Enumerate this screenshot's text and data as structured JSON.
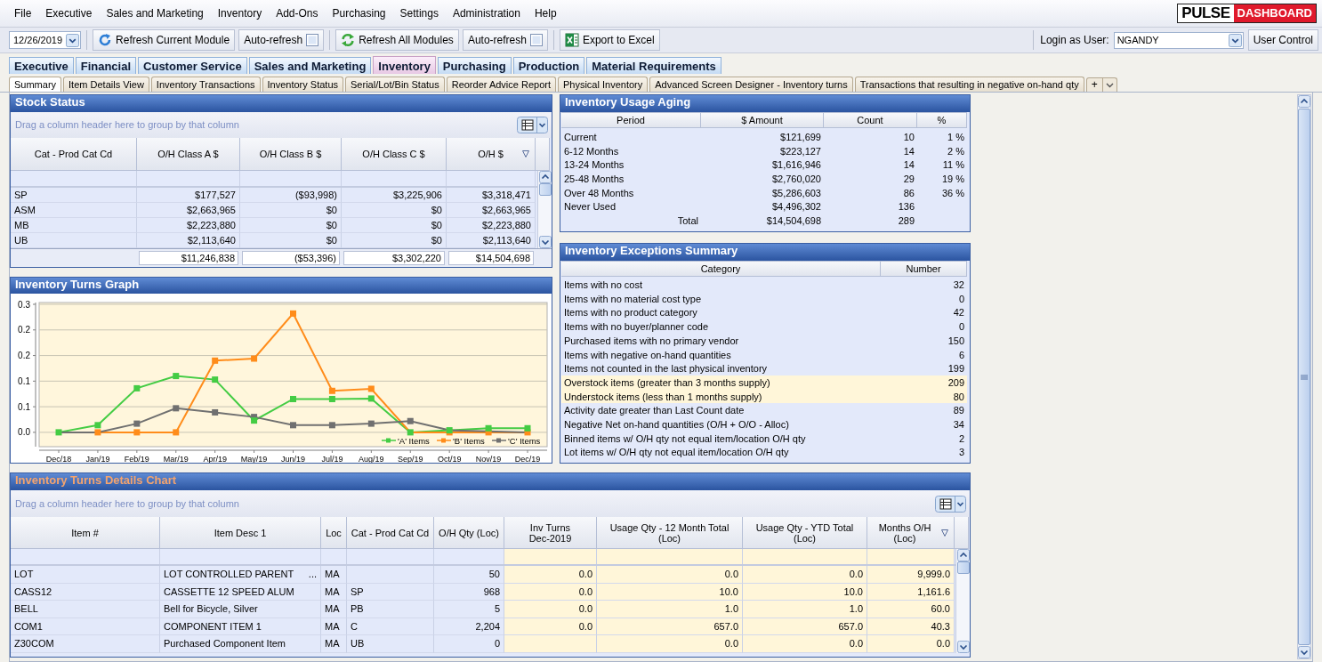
{
  "menu": [
    "File",
    "Executive",
    "Sales and Marketing",
    "Inventory",
    "Add-Ons",
    "Purchasing",
    "Settings",
    "Administration",
    "Help"
  ],
  "logo": {
    "left": "PULSE",
    "right": "DASHBOARD"
  },
  "toolbar": {
    "date": "12/26/2019",
    "refresh_current": "Refresh Current Module",
    "auto_refresh": [
      {
        "label": "Auto-refresh",
        "checked": false
      },
      {
        "label": "Auto-refresh",
        "checked": false
      }
    ],
    "refresh_all": "Refresh All Modules",
    "export": "Export to Excel",
    "login_label": "Login as User:",
    "login_user": "NGANDY",
    "user_control": "User Control"
  },
  "module_tabs": [
    {
      "label": "Executive",
      "selected": false
    },
    {
      "label": "Financial",
      "selected": false
    },
    {
      "label": "Customer Service",
      "selected": false
    },
    {
      "label": "Sales and Marketing",
      "selected": false
    },
    {
      "label": "Inventory",
      "selected": true
    },
    {
      "label": "Purchasing",
      "selected": false
    },
    {
      "label": "Production",
      "selected": false
    },
    {
      "label": "Material Requirements",
      "selected": false
    }
  ],
  "sub_tabs": [
    {
      "label": "Summary",
      "selected": true
    },
    {
      "label": "Item Details View",
      "selected": false
    },
    {
      "label": "Inventory Transactions",
      "selected": false
    },
    {
      "label": "Inventory Status",
      "selected": false
    },
    {
      "label": "Serial/Lot/Bin Status",
      "selected": false
    },
    {
      "label": "Reorder Advice Report",
      "selected": false
    },
    {
      "label": "Physical Inventory",
      "selected": false
    },
    {
      "label": "Advanced Screen Designer - Inventory turns",
      "selected": false
    },
    {
      "label": "Transactions that resulting in negative on-hand qty",
      "selected": false
    }
  ],
  "add_tab": "+",
  "stock_status": {
    "title": "Stock Status",
    "title_highlighted": false,
    "group_hint": "Drag a column header here to group by that column",
    "columns": [
      {
        "label": "Cat - Prod Cat Cd",
        "sorted": false
      },
      {
        "label": "O/H Class A $",
        "sorted": false
      },
      {
        "label": "O/H Class B $",
        "sorted": false
      },
      {
        "label": "O/H Class C $",
        "sorted": false
      },
      {
        "label": "O/H $",
        "sorted": true
      }
    ],
    "rows": [
      [
        "SP",
        "$177,527",
        "($93,998)",
        "$3,225,906",
        "$3,318,471"
      ],
      [
        "ASM",
        "$2,663,965",
        "$0",
        "$0",
        "$2,663,965"
      ],
      [
        "MB",
        "$2,223,880",
        "$0",
        "$0",
        "$2,223,880"
      ],
      [
        "UB",
        "$2,113,640",
        "$0",
        "$0",
        "$2,113,640"
      ]
    ],
    "totals": [
      "$11,246,838",
      "($53,396)",
      "$3,302,220",
      "$14,504,698"
    ]
  },
  "turns_graph": {
    "title": "Inventory Turns Graph",
    "title_highlighted": false,
    "chart_data": {
      "type": "line",
      "categories": [
        "Dec/18",
        "Jan/19",
        "Feb/19",
        "Mar/19",
        "Apr/19",
        "May/19",
        "Jun/19",
        "Jul/19",
        "Aug/19",
        "Sep/19",
        "Oct/19",
        "Nov/19",
        "Dec/19"
      ],
      "ylim": [
        -0.028,
        0.2535
      ],
      "grid": true,
      "legend": true,
      "yticks": [
        {
          "value": 0,
          "label": "0.0"
        },
        {
          "value": 0.05,
          "label": "0.1"
        },
        {
          "value": 0.1,
          "label": "0.1"
        },
        {
          "value": 0.15,
          "label": "0.2"
        },
        {
          "value": 0.2,
          "label": "0.2"
        },
        {
          "value": 0.25,
          "label": "0.3"
        }
      ],
      "series": [
        {
          "name": "'A' Items",
          "color": "#44cc44",
          "marker": "square",
          "values": [
            0,
            0.014,
            0.086,
            0.11,
            0.103,
            0.023,
            0.065,
            0.065,
            0.066,
            0,
            0.004,
            0.008,
            0.008
          ]
        },
        {
          "name": "'B' Items",
          "color": "#ff8c1a",
          "marker": "square",
          "values": [
            null,
            0,
            0,
            0,
            0.14,
            0.144,
            0.232,
            0.081,
            0.085,
            0,
            0,
            0,
            0
          ]
        },
        {
          "name": "'C' Items",
          "color": "#707070",
          "marker": "square",
          "values": [
            0,
            0,
            0.017,
            0.047,
            0.039,
            0.03,
            0.014,
            0.014,
            0.017,
            0.022,
            0.004,
            0.002,
            0
          ]
        }
      ]
    }
  },
  "aging": {
    "title": "Inventory Usage Aging",
    "title_highlighted": false,
    "columns": [
      "Period",
      "$ Amount",
      "Count",
      "%"
    ],
    "rows": [
      {
        "period": "Current",
        "amount": "$121,699",
        "count": "10",
        "pct": "1 %"
      },
      {
        "period": "6-12 Months",
        "amount": "$223,127",
        "count": "14",
        "pct": "2 %"
      },
      {
        "period": "13-24 Months",
        "amount": "$1,616,946",
        "count": "14",
        "pct": "11 %"
      },
      {
        "period": "25-48 Months",
        "amount": "$2,760,020",
        "count": "29",
        "pct": "19 %"
      },
      {
        "period": "Over 48 Months",
        "amount": "$5,286,603",
        "count": "86",
        "pct": "36 %"
      },
      {
        "period": "Never Used",
        "amount": "$4,496,302",
        "count": "136"
      }
    ],
    "total": {
      "label": "Total",
      "amount": "$14,504,698",
      "count": "289"
    }
  },
  "exceptions": {
    "title": "Inventory Exceptions Summary",
    "title_highlighted": false,
    "columns": [
      "Category",
      "Number"
    ],
    "rows": [
      {
        "category": "Items with no cost",
        "number": "32",
        "highlighted": false
      },
      {
        "category": "Items with no material cost type",
        "number": "0",
        "highlighted": false
      },
      {
        "category": "Items with no product category",
        "number": "42",
        "highlighted": false
      },
      {
        "category": "Items with no buyer/planner code",
        "number": "0",
        "highlighted": false
      },
      {
        "category": "Purchased items with no primary vendor",
        "number": "150",
        "highlighted": false
      },
      {
        "category": "Items with negative on-hand quantities",
        "number": "6",
        "highlighted": false
      },
      {
        "category": "Items not counted in the last physical inventory",
        "number": "199",
        "highlighted": false
      },
      {
        "category": "Overstock items (greater than 3 months supply)",
        "number": "209",
        "highlighted": true
      },
      {
        "category": "Understock items (less than 1 months supply)",
        "number": "80",
        "highlighted": true
      },
      {
        "category": "Activity date greater than Last Count date",
        "number": "89",
        "highlighted": false
      },
      {
        "category": "Negative Net on-hand quantities (O/H + O/O - Alloc)",
        "number": "34",
        "highlighted": false
      },
      {
        "category": "Binned items w/ O/H qty not equal item/location O/H qty",
        "number": "2",
        "highlighted": false
      },
      {
        "category": "Lot items w/ O/H qty not equal item/location O/H qty",
        "number": "3",
        "highlighted": false
      }
    ]
  },
  "details": {
    "title": "Inventory Turns Details Chart",
    "title_highlighted": true,
    "group_hint": "Drag a column header here to group by that column",
    "columns": [
      {
        "label": "Item #",
        "highlighted": false,
        "sorted": false
      },
      {
        "label": "Item Desc 1",
        "highlighted": false,
        "sorted": false
      },
      {
        "label": "Loc",
        "highlighted": false,
        "sorted": false
      },
      {
        "label": "Cat - Prod Cat Cd",
        "highlighted": false,
        "sorted": false
      },
      {
        "label": "O/H Qty (Loc)",
        "highlighted": false,
        "sorted": false
      },
      {
        "label": "Inv Turns\nDec-2019",
        "highlighted": true,
        "sorted": false
      },
      {
        "label": "Usage Qty - 12 Month Total (Loc)",
        "highlighted": true,
        "sorted": false
      },
      {
        "label": "Usage Qty - YTD Total (Loc)",
        "highlighted": true,
        "sorted": false
      },
      {
        "label": "Months O/H (Loc)",
        "highlighted": true,
        "sorted": true
      }
    ],
    "rows": [
      {
        "cells": [
          "LOT",
          "LOT CONTROLLED PARENT",
          "MA",
          "",
          "50",
          "0.0",
          "0.0",
          "0.0",
          "9,999.0"
        ],
        "more": "..."
      },
      {
        "cells": [
          "CASS12",
          "CASSETTE 12 SPEED ALUM",
          "MA",
          "SP",
          "968",
          "0.0",
          "10.0",
          "10.0",
          "1,161.6"
        ]
      },
      {
        "cells": [
          "BELL",
          "Bell for Bicycle, Silver",
          "MA",
          "PB",
          "5",
          "0.0",
          "1.0",
          "1.0",
          "60.0"
        ]
      },
      {
        "cells": [
          "COM1",
          "COMPONENT ITEM 1",
          "MA",
          "C",
          "2,204",
          "0.0",
          "657.0",
          "657.0",
          "40.3"
        ]
      },
      {
        "cells": [
          "Z30COM",
          "Purchased Component Item",
          "MA",
          "UB",
          "0",
          "",
          "0.0",
          "0.0",
          "0.0"
        ]
      }
    ]
  }
}
